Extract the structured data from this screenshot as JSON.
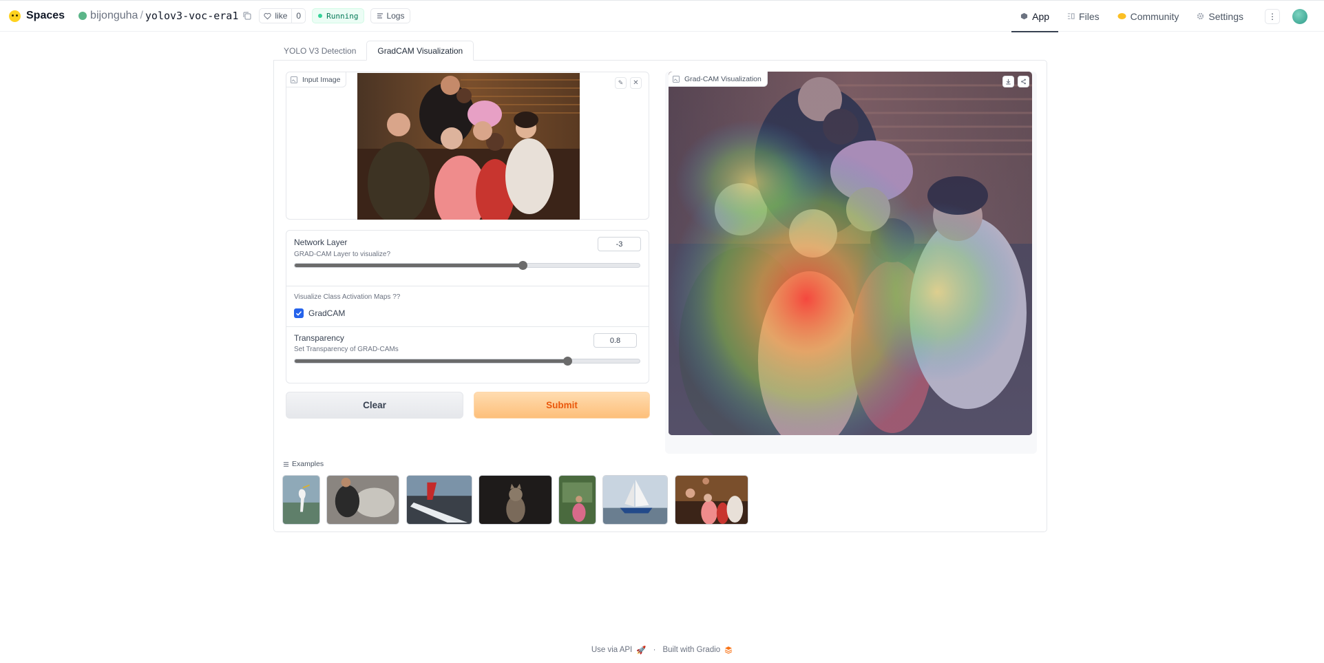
{
  "header": {
    "brand": "Spaces",
    "owner": "bijonguha",
    "separator": "/",
    "repo": "yolov3-voc-era1",
    "like_label": "like",
    "like_count": "0",
    "status": "Running",
    "logs_label": "Logs",
    "nav": [
      {
        "label": "App",
        "icon": "app-cube-icon"
      },
      {
        "label": "Files",
        "icon": "files-icon"
      },
      {
        "label": "Community",
        "icon": "community-icon"
      },
      {
        "label": "Settings",
        "icon": "gear-icon"
      }
    ]
  },
  "tabs": [
    "YOLO V3 Detection",
    "GradCAM Visualization"
  ],
  "input_image": {
    "label": "Input Image"
  },
  "network_layer": {
    "title": "Network Layer",
    "info": "GRAD-CAM Layer to visualize?",
    "value": "-3",
    "slider_fraction": 0.66
  },
  "visualize": {
    "info": "Visualize Class Activation Maps ??",
    "checkbox_label": "GradCAM",
    "checked": true
  },
  "transparency": {
    "title": "Transparency",
    "info": "Set Transparency of GRAD-CAMs",
    "value": "0.8",
    "slider_fraction": 0.79
  },
  "buttons": {
    "clear": "Clear",
    "submit": "Submit"
  },
  "output_image": {
    "label": "Grad-CAM Visualization"
  },
  "examples": {
    "label": "Examples",
    "items": [
      "bird",
      "sheep",
      "airplane",
      "cat",
      "person",
      "boat",
      "family"
    ]
  },
  "footer": {
    "api": "Use via API",
    "dot": "·",
    "built": "Built with Gradio"
  },
  "colors": {
    "accent": "#ea580c",
    "running": "#047857",
    "checkbox": "#2563eb"
  }
}
